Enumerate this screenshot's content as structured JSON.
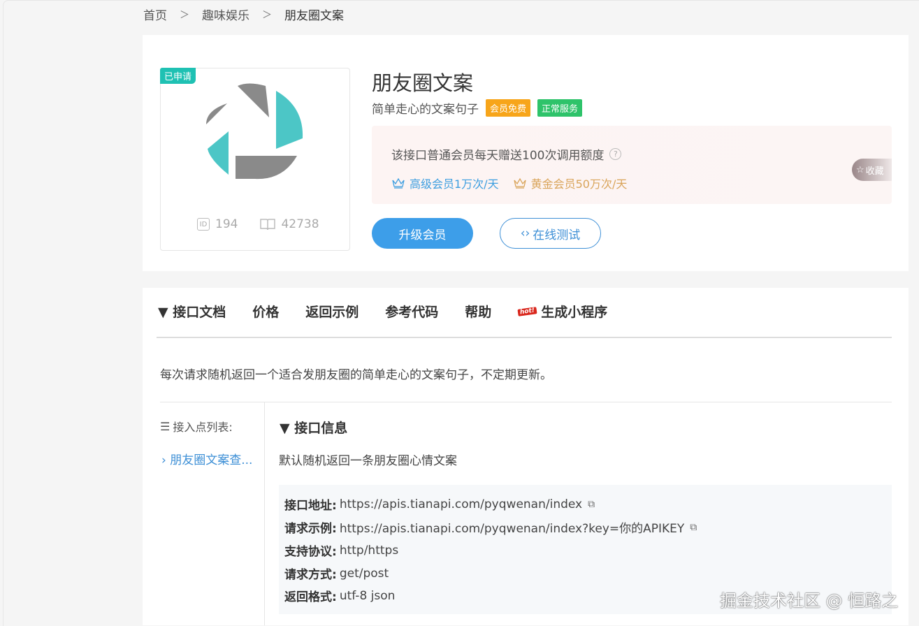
{
  "breadcrumb": {
    "home": "首页",
    "category": "趣味娱乐",
    "current": "朋友圈文案",
    "sep": "＞"
  },
  "api": {
    "badge": "已申请",
    "title": "朋友圈文案",
    "subtitle": "简单走心的文案句子",
    "tags": [
      "会员免费",
      "正常服务"
    ],
    "id_value": "194",
    "views": "42738",
    "id_icon": "ID"
  },
  "quota": {
    "text": "该接口普通会员每天赠送100次调用额度",
    "help": "?",
    "senior": "高级会员1万次/天",
    "gold": "黄金会员50万次/天",
    "fav": "收藏"
  },
  "buttons": {
    "upgrade": "升级会员",
    "test": "在线测试",
    "test_icon": "‹›"
  },
  "tabs": [
    "▼ 接口文档",
    "价格",
    "返回示例",
    "参考代码",
    "帮助",
    "生成小程序"
  ],
  "hot_label": "hot!",
  "description": "每次请求随机返回一个适合发朋友圈的简单走心的文案句子，不定期更新。",
  "endpoints": {
    "title": "接入点列表:",
    "item": "朋友圈文案查..."
  },
  "info": {
    "title": "▼ 接口信息",
    "desc": "默认随机返回一条朋友圈心情文案",
    "rows": [
      {
        "label": "接口地址:",
        "value": "https://apis.tianapi.com/pyqwenan/index"
      },
      {
        "label": "请求示例:",
        "value": "https://apis.tianapi.com/pyqwenan/index?key=你的APIKEY"
      },
      {
        "label": "支持协议:",
        "value": "http/https"
      },
      {
        "label": "请求方式:",
        "value": "get/post"
      },
      {
        "label": "返回格式:",
        "value": "utf-8 json"
      }
    ]
  },
  "watermark": "掘金技术社区 @ 恒路之",
  "colors": {
    "accent": "#3d9ee9",
    "teal": "#1fc1b3",
    "orange": "#f7a51a",
    "green": "#2ec36a",
    "gold": "#d9a45a"
  }
}
